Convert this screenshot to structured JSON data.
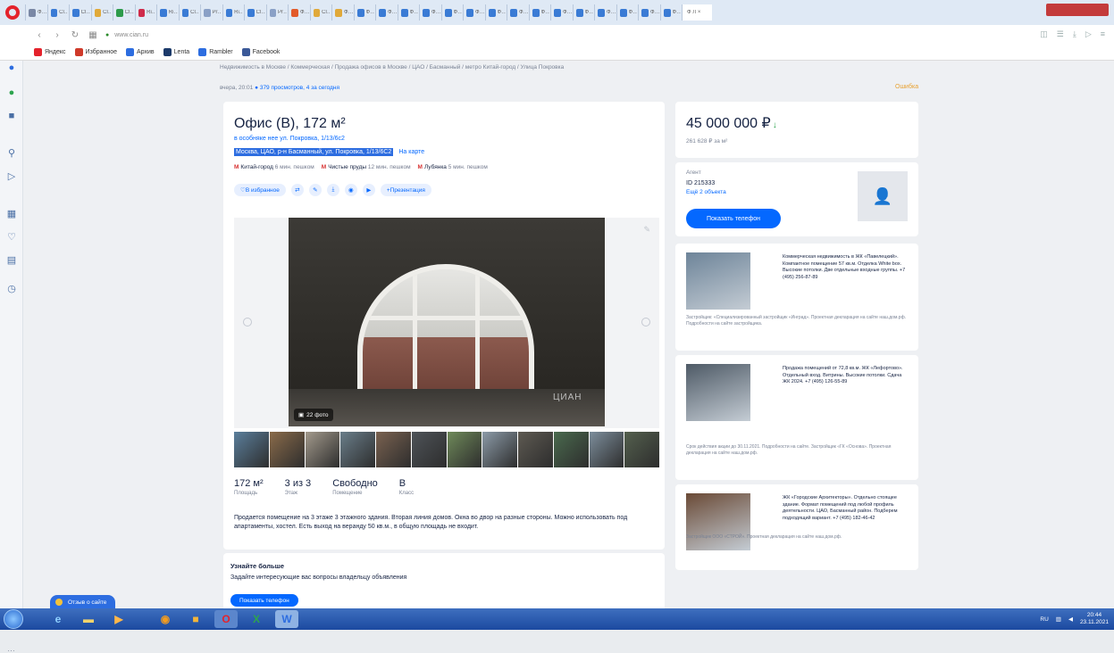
{
  "browser": {
    "tabs": [
      {
        "label": "Ф…",
        "color": "#7a88a5"
      },
      {
        "label": "Cl…",
        "color": "#3a7bd5"
      },
      {
        "label": "Cl…",
        "color": "#3a7bd5"
      },
      {
        "label": "Cl…",
        "color": "#e0a93a"
      },
      {
        "label": "Cl…",
        "color": "#2d9b4b"
      },
      {
        "label": "Ri…",
        "color": "#cf2b4a"
      },
      {
        "label": "Ri…",
        "color": "#3a7bd5"
      },
      {
        "label": "Cl…",
        "color": "#3a7bd5"
      },
      {
        "label": "Pr…",
        "color": "#8aa0c6"
      },
      {
        "label": "Ri…",
        "color": "#3a7bd5"
      },
      {
        "label": "Cl…",
        "color": "#3a7bd5"
      },
      {
        "label": "Pr…",
        "color": "#8aa0c6"
      },
      {
        "label": "Ф…",
        "color": "#e25a2a"
      },
      {
        "label": "Cl…",
        "color": "#e0a93a"
      },
      {
        "label": "Ф…",
        "color": "#e0a93a"
      },
      {
        "label": "Ф…",
        "color": "#3a7bd5"
      },
      {
        "label": "Ф…",
        "color": "#3a7bd5"
      },
      {
        "label": "Ф…",
        "color": "#3a7bd5"
      },
      {
        "label": "Ф…",
        "color": "#3a7bd5"
      },
      {
        "label": "Ф…",
        "color": "#3a7bd5"
      },
      {
        "label": "Ф…",
        "color": "#3a7bd5"
      },
      {
        "label": "Ф…",
        "color": "#3a7bd5"
      },
      {
        "label": "Ф…",
        "color": "#3a7bd5"
      },
      {
        "label": "Ф…",
        "color": "#3a7bd5"
      },
      {
        "label": "Ф…",
        "color": "#3a7bd5"
      },
      {
        "label": "Ф…",
        "color": "#3a7bd5"
      },
      {
        "label": "Ф…",
        "color": "#3a7bd5"
      },
      {
        "label": "Ф…",
        "color": "#3a7bd5"
      },
      {
        "label": "Ф…",
        "color": "#3a7bd5"
      },
      {
        "label": "Ф…",
        "color": "#3a7bd5"
      }
    ],
    "active_tab": "Ф Л ×",
    "address": "www.cian.ru",
    "bookmarks": [
      {
        "label": "Яндекс",
        "color": "#e4232c"
      },
      {
        "label": "Избранное",
        "color": "#cf3a2a"
      },
      {
        "label": "Архив",
        "color": "#2d6de0"
      },
      {
        "label": "Lenta",
        "color": "#1c3a6a"
      },
      {
        "label": "Rambler",
        "color": "#2d6de0"
      },
      {
        "label": "Facebook",
        "color": "#3b5998"
      }
    ]
  },
  "page": {
    "breadcrumb": "Недвижимость в Москве / Коммерческая / Продажа офисов в Москве / ЦАО / Басманный / метро Китай-город / Улица Покровка",
    "date_line": "вчера, 20:01",
    "views": "379 просмотров, 4 за сегодня",
    "report": "Ошибка",
    "title": "Офис (B), 172 м²",
    "subtitle": "в особняке нее ул. Покровка, 1/13/6с2",
    "address": "Москва, ЦАО, р-н Басманный, ул. Покровка, 1/13/6С2",
    "map_link": "На карте",
    "metro": [
      {
        "name": "Китай-город",
        "time": "6 мин. пешком"
      },
      {
        "name": "Чистые пруды",
        "time": "12 мин. пешком"
      },
      {
        "name": "Лубянка",
        "time": "5 мин. пешком"
      }
    ],
    "actions": {
      "favorite": "В избранное",
      "presentation": "Презентация"
    },
    "gallery": {
      "photo_count": "22 фото",
      "watermark": "ЦИАН"
    },
    "facts": [
      {
        "value": "172 м²",
        "label": "Площадь"
      },
      {
        "value": "3 из 3",
        "label": "Этаж"
      },
      {
        "value": "Свободно",
        "label": "Помещение"
      },
      {
        "value": "B",
        "label": "Класс"
      }
    ],
    "description": "Продается помещение на 3 этаже 3 этажного здания. Вторая линия домов. Окна во двор на разные стороны. Можно использовать под апартаменты, хостел. Есть выход на веранду 50 кв.м., в общую площадь не входит.",
    "ask": {
      "title": "Узнайте больше",
      "text": "Задайте интересующие вас вопросы владельцу объявления",
      "button": "Показать телефон"
    }
  },
  "sidebar": {
    "price": "45 000 000 ₽",
    "price_per_m2": "261 628 ₽ за м²",
    "agent_type": "Агент",
    "agent_id": "ID 215333",
    "agent_more": "Ещё 2 объекта",
    "show_phone": "Показать телефон",
    "ads": [
      {
        "text": "Коммерческая недвижимость в ЖК «Павелецкий». Компактное помещение 57 кв.м. Отделка White box. Высокие потолки. Две отдельные входные группы. +7 (495) 256-87-89",
        "foot": "Застройщик: «Специализированный застройщик «Инград». Проектная декларация на сайте наш.дом.рф. Подробности на сайте застройщика."
      },
      {
        "text": "Продажа помещений от 72,8 кв.м. ЖК «Лефортово». Отдельный вход. Витрины. Высокие потолки. Сдача ЖК 2024. +7 (495) 126-55-89",
        "foot": "Срок действия акции до 30.11.2021. Подробности на сайте. Застройщик «ГК «Основа». Проектная декларация на сайте наш.дом.рф."
      },
      {
        "text": "ЖК «Городские Архитекторы». Отдельно стоящее здание. Формат помещений под любой профиль деятельности. ЦАО, Басманный район. Подберем подходящий вариант. +7 (495) 182-46-42",
        "foot": "Застройщик ООО «СТРОЙ». Проектная декларация на сайте наш.дом.рф."
      }
    ]
  },
  "bottom": {
    "chat": "Отзыв о сайте",
    "more": "…"
  },
  "taskbar": {
    "time": "20:44",
    "date": "23.11.2021",
    "lang": "RU"
  }
}
